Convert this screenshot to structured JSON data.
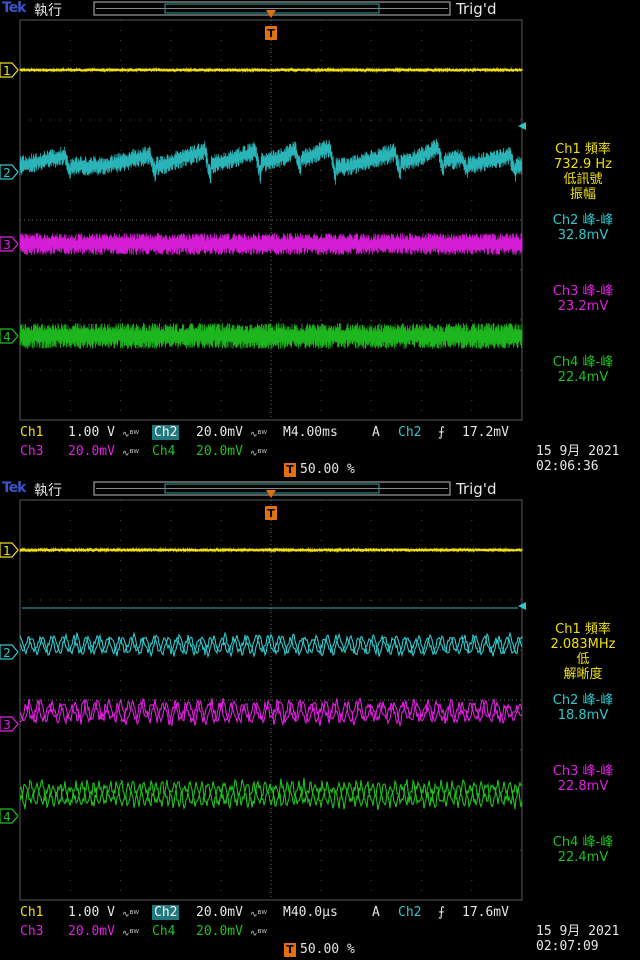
{
  "screens": [
    {
      "header": {
        "brand": "Tek",
        "run_state": "執行",
        "trigger_state": "Trig'd"
      },
      "markers": {
        "ch1": "1",
        "ch2": "2",
        "ch3": "3",
        "ch4": "4",
        "trigger": "T"
      },
      "measurements": [
        {
          "line1": "Ch1 頻率",
          "line2": "732.9 Hz",
          "line3": "低訊號",
          "line4": "振幅"
        },
        {
          "line1": "Ch2 峰-峰",
          "line2": "32.8mV"
        },
        {
          "line1": "Ch3 峰-峰",
          "line2": "23.2mV"
        },
        {
          "line1": "Ch4 峰-峰",
          "line2": "22.4mV"
        }
      ],
      "status": {
        "ch1_label": "Ch1",
        "ch1_scale": "1.00 V",
        "ch2_label": "Ch2",
        "ch2_scale": "20.0mV",
        "ch3_label": "Ch3",
        "ch3_scale": "20.0mV",
        "ch4_label": "Ch4",
        "ch4_scale": "20.0mV",
        "timebase": "M4.00ms",
        "trigger_mode": "A",
        "trigger_source": "Ch2",
        "trigger_level": "17.2mV",
        "trigger_position": "50.00 %",
        "date": "15 9月  2021",
        "time": "02:06:36"
      },
      "waveform_style": {
        "ch2_shape": "slow",
        "colors": {
          "ch1": "#f0e010",
          "ch2": "#30c8cc",
          "ch3": "#e020e0",
          "ch4": "#20c020"
        }
      }
    },
    {
      "header": {
        "brand": "Tek",
        "run_state": "執行",
        "trigger_state": "Trig'd"
      },
      "markers": {
        "ch1": "1",
        "ch2": "2",
        "ch3": "3",
        "ch4": "4",
        "trigger": "T"
      },
      "measurements": [
        {
          "line1": "Ch1 頻率",
          "line2": "2.083MHz",
          "line3": "低",
          "line4": "解晰度"
        },
        {
          "line1": "Ch2 峰-峰",
          "line2": "18.8mV"
        },
        {
          "line1": "Ch3 峰-峰",
          "line2": "22.8mV"
        },
        {
          "line1": "Ch4 峰-峰",
          "line2": "22.4mV"
        }
      ],
      "status": {
        "ch1_label": "Ch1",
        "ch1_scale": "1.00 V",
        "ch2_label": "Ch2",
        "ch2_scale": "20.0mV",
        "ch3_label": "Ch3",
        "ch3_scale": "20.0mV",
        "ch4_label": "Ch4",
        "ch4_scale": "20.0mV",
        "timebase": "M40.0µs",
        "trigger_mode": "A",
        "trigger_source": "Ch2",
        "trigger_level": "17.6mV",
        "trigger_position": "50.00 %",
        "date": "15 9月  2021",
        "time": "02:07:09"
      },
      "waveform_style": {
        "ch2_shape": "sawtooth",
        "colors": {
          "ch1": "#f0e010",
          "ch2": "#30c8cc",
          "ch3": "#e020e0",
          "ch4": "#20c020"
        }
      }
    }
  ]
}
